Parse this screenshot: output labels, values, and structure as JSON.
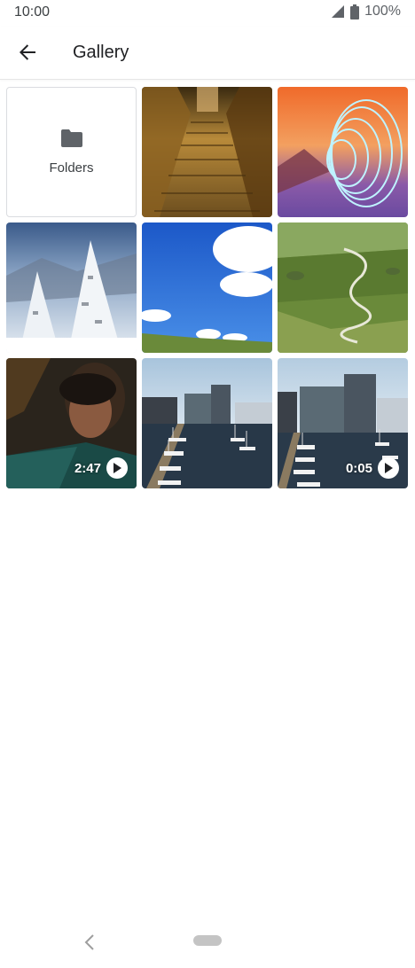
{
  "status_bar": {
    "time": "10:00",
    "battery": "100%",
    "icons": [
      "signal-icon",
      "battery-icon"
    ]
  },
  "app_bar": {
    "title": "Gallery",
    "back_icon": "arrow-back-icon"
  },
  "grid": {
    "folders_label": "Folders",
    "items": [
      {
        "kind": "photo",
        "subject": "stone staircase"
      },
      {
        "kind": "photo",
        "subject": "light painting spiral at sunset"
      },
      {
        "kind": "photo",
        "subject": "snow-covered trees"
      },
      {
        "kind": "photo",
        "subject": "blue sky with clouds"
      },
      {
        "kind": "photo",
        "subject": "winding mountain road"
      },
      {
        "kind": "video",
        "subject": "person in dark room",
        "duration": "2:47"
      },
      {
        "kind": "photo",
        "subject": "harbor with boats"
      },
      {
        "kind": "video",
        "subject": "harbor with boats",
        "duration": "0:05"
      }
    ]
  },
  "colors": {
    "accent_text": "#202124",
    "divider": "#e6e6e6",
    "folder_icon": "#5f6368",
    "nav_pill": "#c4c4c4"
  }
}
